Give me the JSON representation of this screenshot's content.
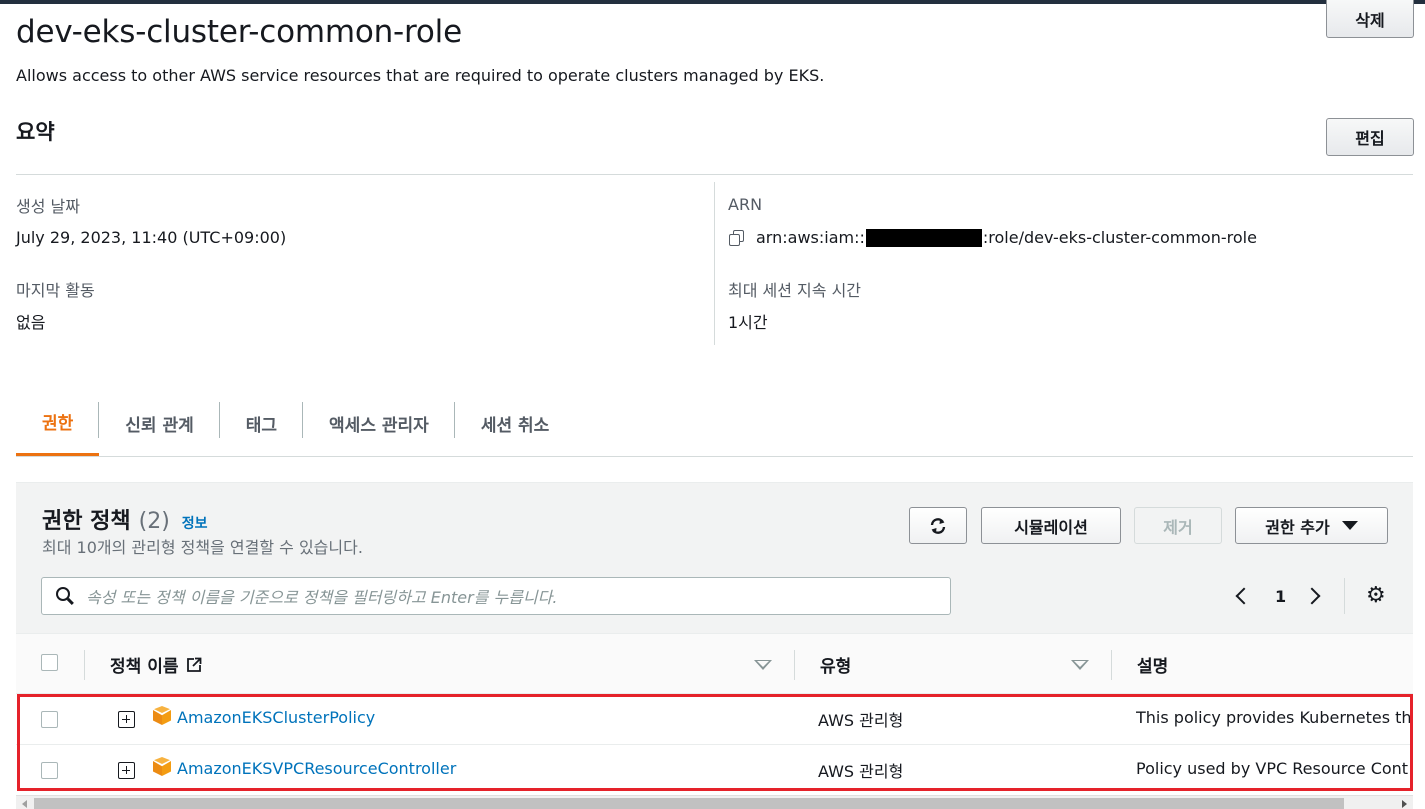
{
  "role": {
    "name": "dev-eks-cluster-common-role",
    "description": "Allows access to other AWS service resources that are required to operate clusters managed by EKS.",
    "delete_label": "삭제"
  },
  "summary": {
    "title": "요약",
    "edit_label": "편집",
    "created_label": "생성 날짜",
    "created_value": "July 29, 2023, 11:40 (UTC+09:00)",
    "last_activity_label": "마지막 활동",
    "last_activity_value": "없음",
    "arn_label": "ARN",
    "arn_prefix": "arn:aws:iam::",
    "arn_suffix": ":role/dev-eks-cluster-common-role",
    "max_session_label": "최대 세션 지속 시간",
    "max_session_value": "1시간"
  },
  "tabs": [
    {
      "label": "권한",
      "active": true
    },
    {
      "label": "신뢰 관계",
      "active": false
    },
    {
      "label": "태그",
      "active": false
    },
    {
      "label": "액세스 관리자",
      "active": false
    },
    {
      "label": "세션 취소",
      "active": false
    }
  ],
  "permissions": {
    "title": "권한 정책",
    "count": "(2)",
    "info_label": "정보",
    "subtitle": "최대 10개의 관리형 정책을 연결할 수 있습니다.",
    "simulate_label": "시뮬레이션",
    "remove_label": "제거",
    "add_label": "권한 추가",
    "search_placeholder": "속성 또는 정책 이름을 기준으로 정책을 필터링하고 Enter를 누릅니다.",
    "page_number": "1",
    "columns": {
      "name": "정책 이름",
      "type": "유형",
      "description": "설명"
    },
    "rows": [
      {
        "name": "AmazonEKSClusterPolicy",
        "type": "AWS 관리형",
        "description": "This policy provides Kubernetes the"
      },
      {
        "name": "AmazonEKSVPCResourceController",
        "type": "AWS 관리형",
        "description": "Policy used by VPC Resource Cont"
      }
    ]
  },
  "icons": {
    "copy": "copy-icon",
    "refresh": "refresh-icon",
    "search": "search-icon",
    "settings": "gear-icon",
    "external": "external-link-icon",
    "expand": "expand-icon",
    "policy": "package-icon"
  },
  "colors": {
    "accent": "#ec7211",
    "link": "#0073bb",
    "highlight": "#e5222a"
  }
}
